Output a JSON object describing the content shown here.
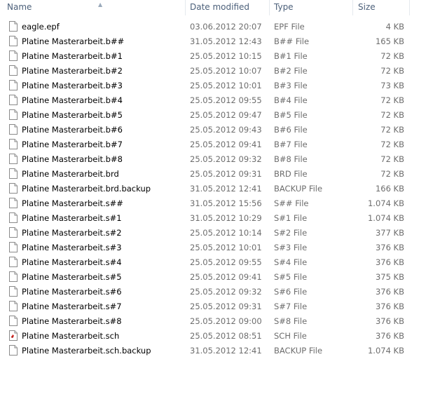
{
  "columns": {
    "name": "Name",
    "date": "Date modified",
    "type": "Type",
    "size": "Size"
  },
  "icons": {
    "file": "file-icon",
    "sch": "eagle-schematic-icon"
  },
  "files": [
    {
      "name": "eagle.epf",
      "date": "03.06.2012 20:07",
      "type": "EPF File",
      "size": "4 KB",
      "icon": "file"
    },
    {
      "name": "Platine Masterarbeit.b##",
      "date": "31.05.2012 12:43",
      "type": "B## File",
      "size": "165 KB",
      "icon": "file"
    },
    {
      "name": "Platine Masterarbeit.b#1",
      "date": "25.05.2012 10:15",
      "type": "B#1 File",
      "size": "72 KB",
      "icon": "file"
    },
    {
      "name": "Platine Masterarbeit.b#2",
      "date": "25.05.2012 10:07",
      "type": "B#2 File",
      "size": "72 KB",
      "icon": "file"
    },
    {
      "name": "Platine Masterarbeit.b#3",
      "date": "25.05.2012 10:01",
      "type": "B#3 File",
      "size": "73 KB",
      "icon": "file"
    },
    {
      "name": "Platine Masterarbeit.b#4",
      "date": "25.05.2012 09:55",
      "type": "B#4 File",
      "size": "72 KB",
      "icon": "file"
    },
    {
      "name": "Platine Masterarbeit.b#5",
      "date": "25.05.2012 09:47",
      "type": "B#5 File",
      "size": "72 KB",
      "icon": "file"
    },
    {
      "name": "Platine Masterarbeit.b#6",
      "date": "25.05.2012 09:43",
      "type": "B#6 File",
      "size": "72 KB",
      "icon": "file"
    },
    {
      "name": "Platine Masterarbeit.b#7",
      "date": "25.05.2012 09:41",
      "type": "B#7 File",
      "size": "72 KB",
      "icon": "file"
    },
    {
      "name": "Platine Masterarbeit.b#8",
      "date": "25.05.2012 09:32",
      "type": "B#8 File",
      "size": "72 KB",
      "icon": "file"
    },
    {
      "name": "Platine Masterarbeit.brd",
      "date": "25.05.2012 09:31",
      "type": "BRD File",
      "size": "72 KB",
      "icon": "file"
    },
    {
      "name": "Platine Masterarbeit.brd.backup",
      "date": "31.05.2012 12:41",
      "type": "BACKUP File",
      "size": "166 KB",
      "icon": "file"
    },
    {
      "name": "Platine Masterarbeit.s##",
      "date": "31.05.2012 15:56",
      "type": "S## File",
      "size": "1.074 KB",
      "icon": "file"
    },
    {
      "name": "Platine Masterarbeit.s#1",
      "date": "31.05.2012 10:29",
      "type": "S#1 File",
      "size": "1.074 KB",
      "icon": "file"
    },
    {
      "name": "Platine Masterarbeit.s#2",
      "date": "25.05.2012 10:14",
      "type": "S#2 File",
      "size": "377 KB",
      "icon": "file"
    },
    {
      "name": "Platine Masterarbeit.s#3",
      "date": "25.05.2012 10:01",
      "type": "S#3 File",
      "size": "376 KB",
      "icon": "file"
    },
    {
      "name": "Platine Masterarbeit.s#4",
      "date": "25.05.2012 09:55",
      "type": "S#4 File",
      "size": "376 KB",
      "icon": "file"
    },
    {
      "name": "Platine Masterarbeit.s#5",
      "date": "25.05.2012 09:41",
      "type": "S#5 File",
      "size": "375 KB",
      "icon": "file"
    },
    {
      "name": "Platine Masterarbeit.s#6",
      "date": "25.05.2012 09:32",
      "type": "S#6 File",
      "size": "376 KB",
      "icon": "file"
    },
    {
      "name": "Platine Masterarbeit.s#7",
      "date": "25.05.2012 09:31",
      "type": "S#7 File",
      "size": "376 KB",
      "icon": "file"
    },
    {
      "name": "Platine Masterarbeit.s#8",
      "date": "25.05.2012 09:00",
      "type": "S#8 File",
      "size": "376 KB",
      "icon": "file"
    },
    {
      "name": "Platine Masterarbeit.sch",
      "date": "25.05.2012 08:51",
      "type": "SCH File",
      "size": "376 KB",
      "icon": "sch"
    },
    {
      "name": "Platine Masterarbeit.sch.backup",
      "date": "31.05.2012 12:41",
      "type": "BACKUP File",
      "size": "1.074 KB",
      "icon": "file"
    }
  ]
}
